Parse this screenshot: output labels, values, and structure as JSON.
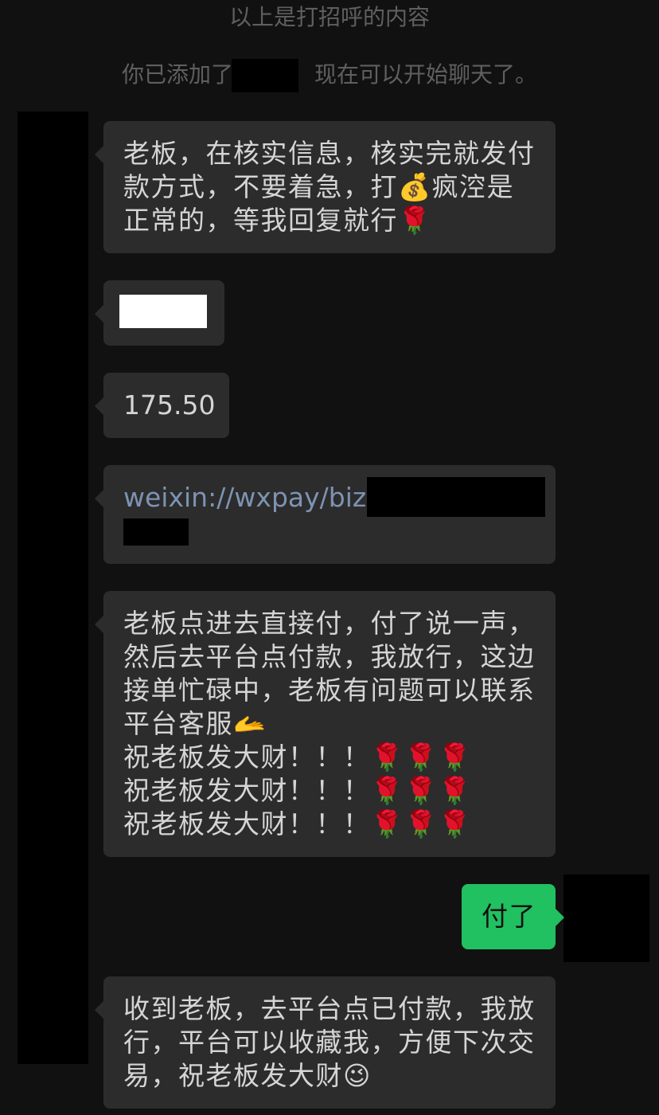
{
  "system": {
    "greeting_note": "以上是打招呼的内容",
    "added_prefix": "你已添加了",
    "added_suffix": "现在可以开始聊天了。"
  },
  "messages": {
    "m1": {
      "lines": [
        "老板，在核实信息，核实完就发付",
        "款方式，不要着急，打💰疯涳是",
        "正常的，等我回复就行🌹"
      ]
    },
    "m3": {
      "text": "175.50"
    },
    "m4": {
      "text": "weixin://wxpay/bizpa"
    },
    "m5": {
      "lines": [
        "老板点进去直接付，付了说一声，",
        "然后去平台点付款，我放行，这边",
        "接单忙碌中，老板有问题可以联系",
        "平台客服🫴",
        "祝老板发大财！！！🌹🌹🌹",
        "祝老板发大财！！！🌹🌹🌹",
        "祝老板发大财！！！🌹🌹🌹"
      ]
    },
    "m6": {
      "text": "付了"
    },
    "m7": {
      "lines": [
        "收到老板，去平台点已付款，我放",
        "行，平台可以收藏我，方便下次交",
        "易，祝老板发大财😉"
      ]
    }
  },
  "colors": {
    "background": "#111111",
    "incoming_bubble": "#2c2c2c",
    "outgoing_bubble": "#21c060",
    "link": "#7d93b2",
    "system_text": "#5f5f5f"
  }
}
